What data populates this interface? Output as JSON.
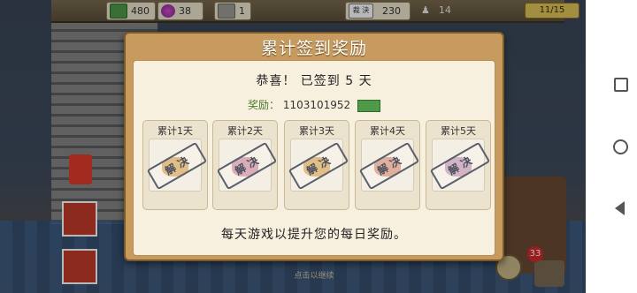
{
  "topbar": {
    "cash": "480",
    "gems": "38",
    "papers": "1",
    "stamp_label": "裁 決",
    "stamp_count": "230",
    "staff_count": "14",
    "level": "11/15"
  },
  "dialog": {
    "title": "累计签到奖励",
    "congrats": "恭喜！  已签到 5 天",
    "reward_label": "奖励：",
    "reward_value": "1103101952",
    "days": [
      {
        "label": "累计1天",
        "stamp": "解 决",
        "color": "#d7b06a"
      },
      {
        "label": "累计2天",
        "stamp": "解 决",
        "color": "#d09aa8"
      },
      {
        "label": "累计3天",
        "stamp": "解 决",
        "color": "#d7b06a"
      },
      {
        "label": "累计4天",
        "stamp": "解 决",
        "color": "#d99b86"
      },
      {
        "label": "累计5天",
        "stamp": "解 决",
        "color": "#c9a0b8"
      }
    ],
    "footer": "每天游戏以提升您的每日奖励。",
    "continue": "点击以继续"
  },
  "badges": {
    "notifications": "33"
  }
}
